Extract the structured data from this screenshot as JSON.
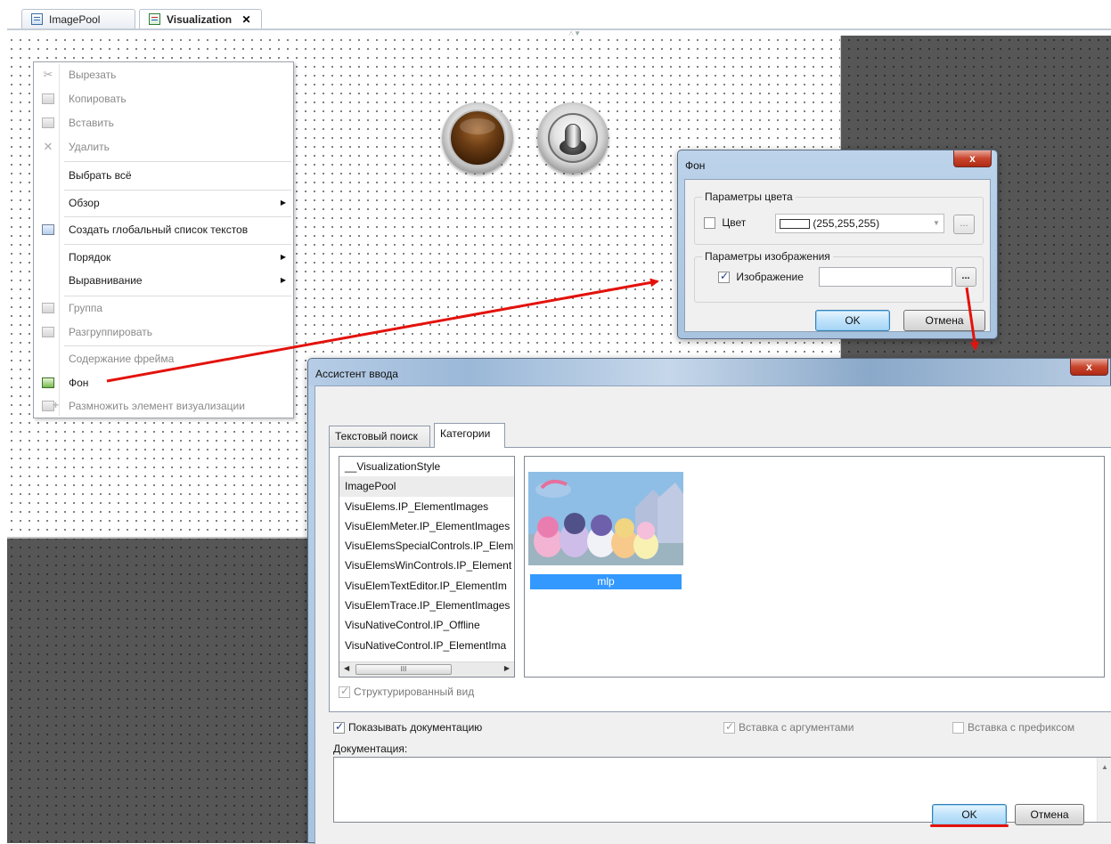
{
  "tabs": [
    {
      "label": "ImagePool",
      "active": false
    },
    {
      "label": "Visualization",
      "active": true,
      "close": "✕"
    }
  ],
  "context_menu": {
    "items": [
      {
        "label": "Вырезать",
        "icon": "scissors-icon",
        "disabled": true
      },
      {
        "label": "Копировать",
        "icon": "copy-icon",
        "disabled": true
      },
      {
        "label": "Вставить",
        "icon": "paste-icon",
        "disabled": true
      },
      {
        "label": "Удалить",
        "icon": "delete-icon",
        "disabled": true
      },
      {
        "label": "Выбрать всё",
        "disabled": false
      },
      {
        "label": "Обзор",
        "submenu": true,
        "disabled": false
      },
      {
        "label": "Создать глобальный список текстов",
        "icon": "text-list-icon",
        "disabled": false
      },
      {
        "label": "Порядок",
        "submenu": true,
        "disabled": false
      },
      {
        "label": "Выравнивание",
        "submenu": true,
        "disabled": false
      },
      {
        "label": "Группа",
        "icon": "group-icon",
        "disabled": true
      },
      {
        "label": "Разгруппировать",
        "icon": "ungroup-icon",
        "disabled": true
      },
      {
        "label": "Содержание фрейма",
        "disabled": true
      },
      {
        "label": "Фон",
        "icon": "background-icon",
        "disabled": false
      },
      {
        "label": "Размножить элемент визуализации",
        "icon": "multiply-element-icon",
        "disabled": true
      }
    ]
  },
  "background_dialog": {
    "title": "Фон",
    "close": "x",
    "color_group": {
      "title": "Параметры цвета",
      "checkbox_label": "Цвет",
      "checked": false,
      "color_value": "(255,255,255)",
      "swatch_color": "#ffffff",
      "dots": "..."
    },
    "image_group": {
      "title": "Параметры изображения",
      "checkbox_label": "Изображение",
      "checked": true,
      "value": "",
      "dots": "..."
    },
    "ok": "OK",
    "cancel": "Отмена"
  },
  "input_assistant": {
    "title": "Ассистент ввода",
    "close": "x",
    "tabs": [
      {
        "label": "Текстовый поиск",
        "active": false
      },
      {
        "label": "Категории",
        "active": true
      }
    ],
    "categories": [
      "__VisualizationStyle",
      "ImagePool",
      "VisuElems.IP_ElementImages",
      "VisuElemMeter.IP_ElementImages",
      "VisuElemsSpecialControls.IP_Elem",
      "VisuElemsWinControls.IP_Element",
      "VisuElemTextEditor.IP_ElementIm",
      "VisuElemTrace.IP_ElementImages",
      "VisuNativeControl.IP_Offline",
      "VisuNativeControl.IP_ElementIma"
    ],
    "selected_category": "ImagePool",
    "scroll_thumb": "III",
    "image_item": "mlp",
    "structured_view": {
      "label": "Структурированный вид",
      "checked": true,
      "disabled": true
    },
    "show_docs": {
      "label": "Показывать документацию",
      "checked": true
    },
    "insert_args": {
      "label": "Вставка с аргументами",
      "checked": true,
      "disabled": true
    },
    "insert_prefix": {
      "label": "Вставка с префиксом",
      "checked": false,
      "disabled": true
    },
    "doc_label": "Документация:",
    "ok": "OK",
    "cancel": "Отмена"
  },
  "colors": {
    "annotation_arrow": "#e3120b",
    "selection_blue": "#3399ff",
    "canvas_gray": "#565656"
  }
}
